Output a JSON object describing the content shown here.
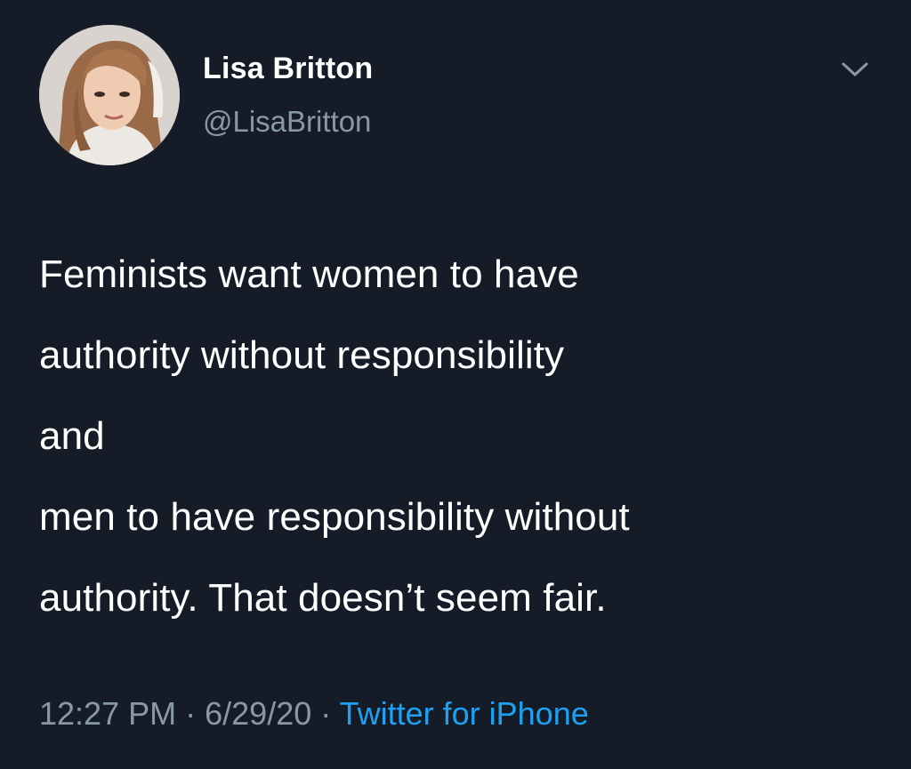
{
  "user": {
    "display_name": "Lisa Britton",
    "handle": "@LisaBritton"
  },
  "tweet": {
    "lines": [
      "Feminists want women to have",
      "authority without responsibility",
      "and",
      "men to have responsibility without",
      "authority. That doesn’t seem fair."
    ],
    "time": "12:27 PM",
    "separator": "·",
    "date": "6/29/20",
    "source": "Twitter for iPhone"
  },
  "icons": {
    "menu": "chevron-down-icon"
  },
  "colors": {
    "background": "#151c28",
    "primary_text": "#ffffff",
    "secondary_text": "#8899a6",
    "link": "#1da1f2"
  }
}
